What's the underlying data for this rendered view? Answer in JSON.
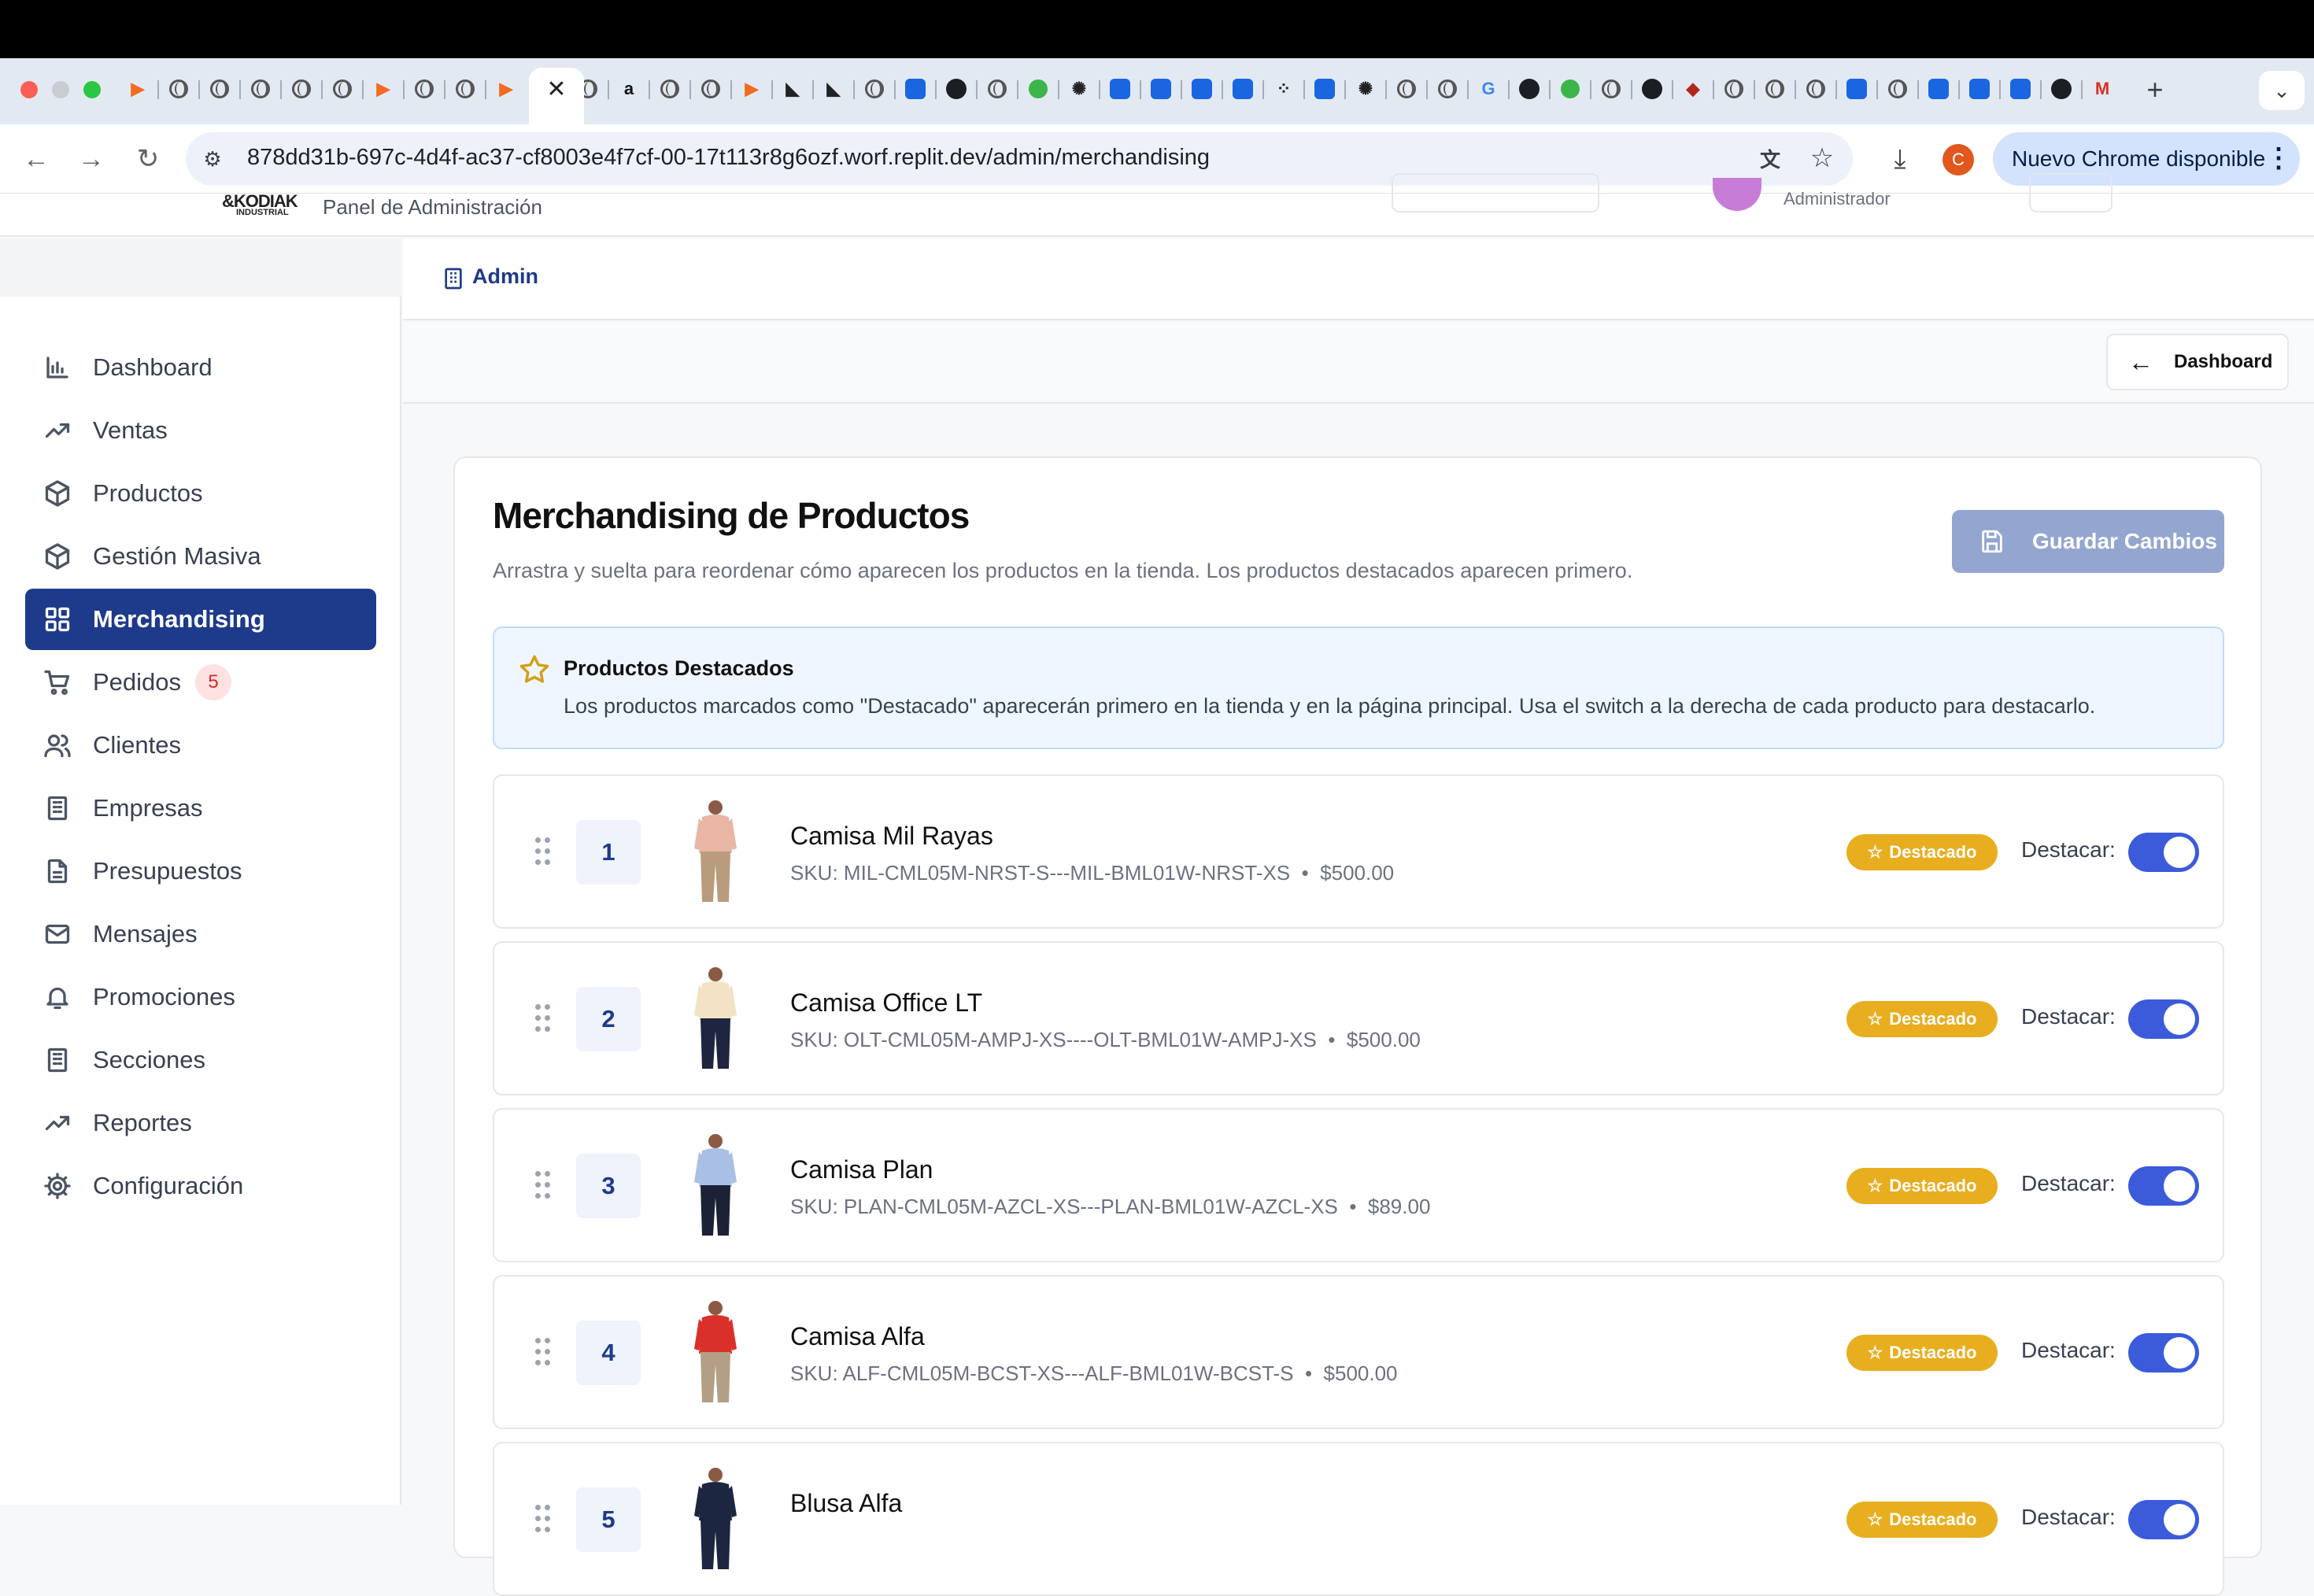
{
  "browser": {
    "url": "878dd31b-697c-4d4f-ac37-cf8003e4f7cf-00-17t113r8g6ozf.worf.replit.dev/admin/merchandising",
    "update_button": "Nuevo Chrome disponible",
    "profile_initial": "C",
    "new_tab": "+",
    "tab_search": "⌄",
    "active_tab_close": "✕"
  },
  "header": {
    "logo_brand": "&KODIAK",
    "logo_sub": "INDUSTRIAL",
    "panel_title": "Panel de Administración",
    "user_role": "Administrador"
  },
  "breadcrumb": {
    "label": "Admin"
  },
  "page_bar": {
    "dashboard_button": "Dashboard"
  },
  "sidebar": {
    "items": [
      {
        "label": "Dashboard",
        "icon": "bar-chart-icon"
      },
      {
        "label": "Ventas",
        "icon": "trending-up-icon"
      },
      {
        "label": "Productos",
        "icon": "package-icon"
      },
      {
        "label": "Gestión Masiva",
        "icon": "package-icon"
      },
      {
        "label": "Merchandising",
        "icon": "grid-icon",
        "active": true
      },
      {
        "label": "Pedidos",
        "icon": "cart-icon",
        "badge": "5"
      },
      {
        "label": "Clientes",
        "icon": "users-icon"
      },
      {
        "label": "Empresas",
        "icon": "building-icon"
      },
      {
        "label": "Presupuestos",
        "icon": "file-text-icon"
      },
      {
        "label": "Mensajes",
        "icon": "mail-icon"
      },
      {
        "label": "Promociones",
        "icon": "bell-icon"
      },
      {
        "label": "Secciones",
        "icon": "building-icon"
      },
      {
        "label": "Reportes",
        "icon": "trending-up-icon"
      },
      {
        "label": "Configuración",
        "icon": "gear-icon"
      }
    ]
  },
  "main": {
    "title": "Merchandising de Productos",
    "subtitle": "Arrastra y suelta para reordenar cómo aparecen los productos en la tienda. Los productos destacados aparecen primero.",
    "save_button": "Guardar Cambios",
    "info": {
      "title": "Productos Destacados",
      "text": "Los productos marcados como \"Destacado\" aparecerán primero en la tienda y en la página principal. Usa el switch a la derecha de cada producto para destacarlo."
    },
    "featured_badge": "Destacado",
    "feature_label": "Destacar:",
    "products": [
      {
        "position": "1",
        "name": "Camisa Mil Rayas",
        "sku": "SKU: MIL-CML05M-NRST-S---MIL-BML01W-NRST-XS",
        "price": "$500.00",
        "featured": true,
        "shirt_color": "#e9b5a5",
        "pants_color": "#b99c7d"
      },
      {
        "position": "2",
        "name": "Camisa Office LT",
        "sku": "SKU: OLT-CML05M-AMPJ-XS----OLT-BML01W-AMPJ-XS",
        "price": "$500.00",
        "featured": true,
        "shirt_color": "#f3e2c4",
        "pants_color": "#1f2540"
      },
      {
        "position": "3",
        "name": "Camisa Plan",
        "sku": "SKU: PLAN-CML05M-AZCL-XS---PLAN-BML01W-AZCL-XS",
        "price": "$89.00",
        "featured": true,
        "shirt_color": "#a9c0e4",
        "pants_color": "#1c2236"
      },
      {
        "position": "4",
        "name": "Camisa Alfa",
        "sku": "SKU: ALF-CML05M-BCST-XS---ALF-BML01W-BCST-S",
        "price": "$500.00",
        "featured": true,
        "shirt_color": "#d9302b",
        "pants_color": "#b29f86"
      },
      {
        "position": "5",
        "name": "Blusa Alfa",
        "sku": "",
        "price": "",
        "featured": true,
        "shirt_color": "#1c2640",
        "pants_color": "#1c2640"
      }
    ]
  }
}
